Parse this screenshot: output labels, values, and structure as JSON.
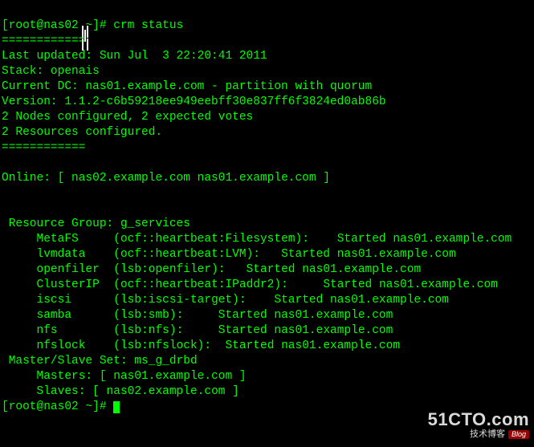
{
  "prompt": {
    "user": "root",
    "host": "nas02",
    "path": "~",
    "symbol": "#",
    "command": "crm status"
  },
  "sep1": "============",
  "last_updated_label": "Last updated:",
  "last_updated_value": "Sun Jul  3 22:20:41 2011",
  "stack_label": "Stack:",
  "stack_value": "openais",
  "current_dc_label": "Current DC:",
  "current_dc_value": "nas01.example.com - partition with quorum",
  "version_label": "Version:",
  "version_value": "1.1.2-c6b59218ee949eebff30e837ff6f3824ed0ab86b",
  "nodes_line": "2 Nodes configured, 2 expected votes",
  "resources_line": "2 Resources configured.",
  "sep2": "============",
  "online_label": "Online:",
  "online_nodes": "[ nas02.example.com nas01.example.com ]",
  "resource_group_label": "Resource Group:",
  "resource_group_name": "g_services",
  "resources": [
    {
      "name": "MetaFS",
      "provider": "(ocf::heartbeat:Filesystem):",
      "state": "Started",
      "node": "nas01.example.com"
    },
    {
      "name": "lvmdata",
      "provider": "(ocf::heartbeat:LVM):",
      "state": "Started",
      "node": "nas01.example.com"
    },
    {
      "name": "openfiler",
      "provider": "(lsb:openfiler):",
      "state": "Started",
      "node": "nas01.example.com"
    },
    {
      "name": "ClusterIP",
      "provider": "(ocf::heartbeat:IPaddr2):",
      "state": "Started",
      "node": "nas01.example.com"
    },
    {
      "name": "iscsi",
      "provider": "(lsb:iscsi-target):",
      "state": "Started",
      "node": "nas01.example.com"
    },
    {
      "name": "samba",
      "provider": "(lsb:smb):",
      "state": "Started",
      "node": "nas01.example.com"
    },
    {
      "name": "nfs",
      "provider": "(lsb:nfs):",
      "state": "Started",
      "node": "nas01.example.com"
    },
    {
      "name": "nfslock",
      "provider": "(lsb:nfslock):",
      "state": "Started",
      "node": "nas01.example.com"
    }
  ],
  "ms_label": "Master/Slave Set:",
  "ms_name": "ms_g_drbd",
  "masters_label": "Masters:",
  "masters_value": "[ nas01.example.com ]",
  "slaves_label": "Slaves:",
  "slaves_value": "[ nas02.example.com ]",
  "watermark": {
    "domain": "51CTO.com",
    "sub": "技术博客",
    "badge": "Blog"
  }
}
